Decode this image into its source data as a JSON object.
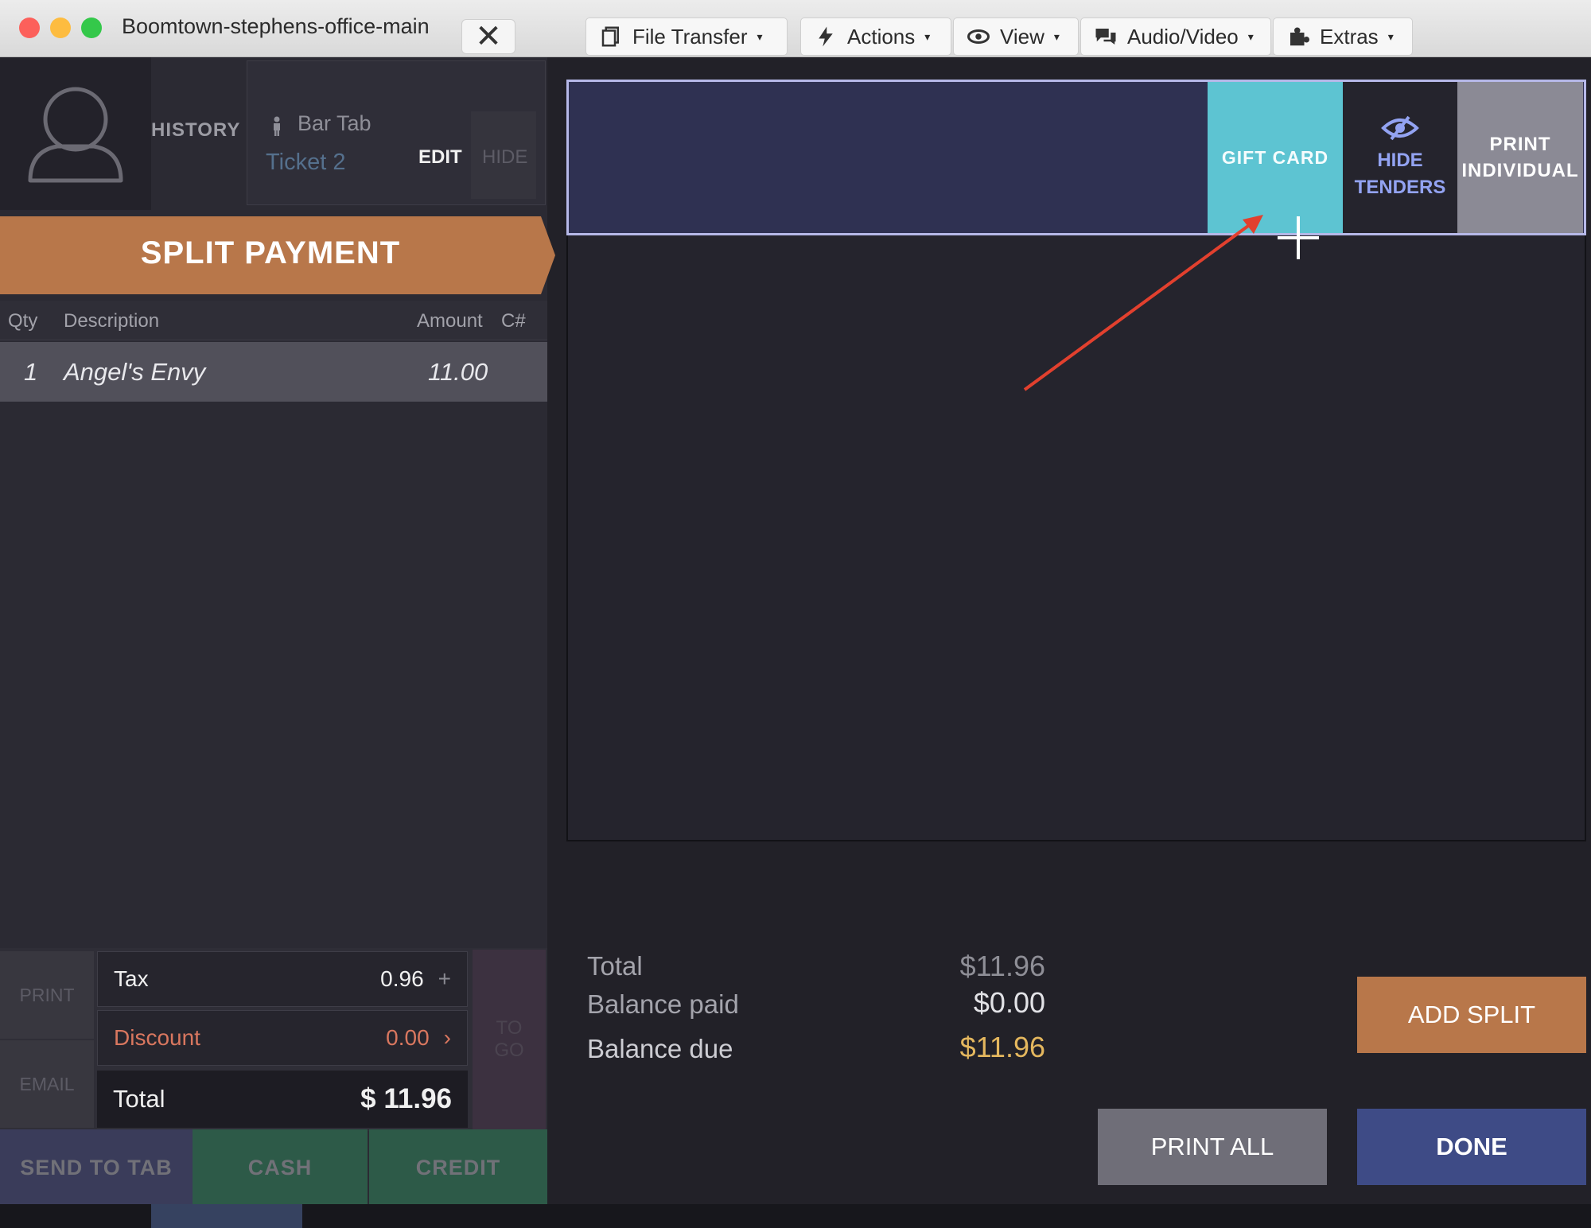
{
  "window": {
    "title": "Boomtown-stephens-office-main"
  },
  "toolbar": {
    "file_transfer": "File Transfer",
    "actions": "Actions",
    "view": "View",
    "audio_video": "Audio/Video",
    "extras": "Extras"
  },
  "ticket": {
    "history_label": "HISTORY",
    "tab_name": "Bar Tab",
    "ticket_label": "Ticket 2",
    "edit_label": "EDIT",
    "hide_label": "HIDE",
    "banner": "SPLIT PAYMENT"
  },
  "grid": {
    "headers": {
      "qty": "Qty",
      "description": "Description",
      "amount": "Amount",
      "course": "C#"
    },
    "items": [
      {
        "qty": "1",
        "description": "Angel's Envy",
        "amount": "11.00"
      }
    ]
  },
  "totals_left": {
    "print_label": "PRINT",
    "email_label": "EMAIL",
    "tax_label": "Tax",
    "tax_value": "0.96",
    "discount_label": "Discount",
    "discount_value": "0.00",
    "total_label": "Total",
    "total_value": "$ 11.96",
    "to_go_line1": "TO",
    "to_go_line2": "GO"
  },
  "actions_left": {
    "send_to_tab": "SEND TO TAB",
    "cash": "CASH",
    "credit": "CREDIT"
  },
  "tenders": {
    "gift_card": "GIFT CARD",
    "hide_tenders_line1": "HIDE",
    "hide_tenders_line2": "TENDERS",
    "print_individual_line1": "PRINT",
    "print_individual_line2": "INDIVIDUAL"
  },
  "summary": {
    "total_label": "Total",
    "total_value": "$11.96",
    "paid_label": "Balance paid",
    "paid_value": "$0.00",
    "due_label": "Balance due",
    "due_value": "$11.96"
  },
  "buttons": {
    "add_split": "ADD SPLIT",
    "print_all": "PRINT ALL",
    "done": "DONE"
  },
  "colors": {
    "accent_orange": "#b8774a",
    "gift_card": "#5dc4d2",
    "done_blue": "#3e4b86",
    "annotation_arrow": "#e2402e"
  }
}
